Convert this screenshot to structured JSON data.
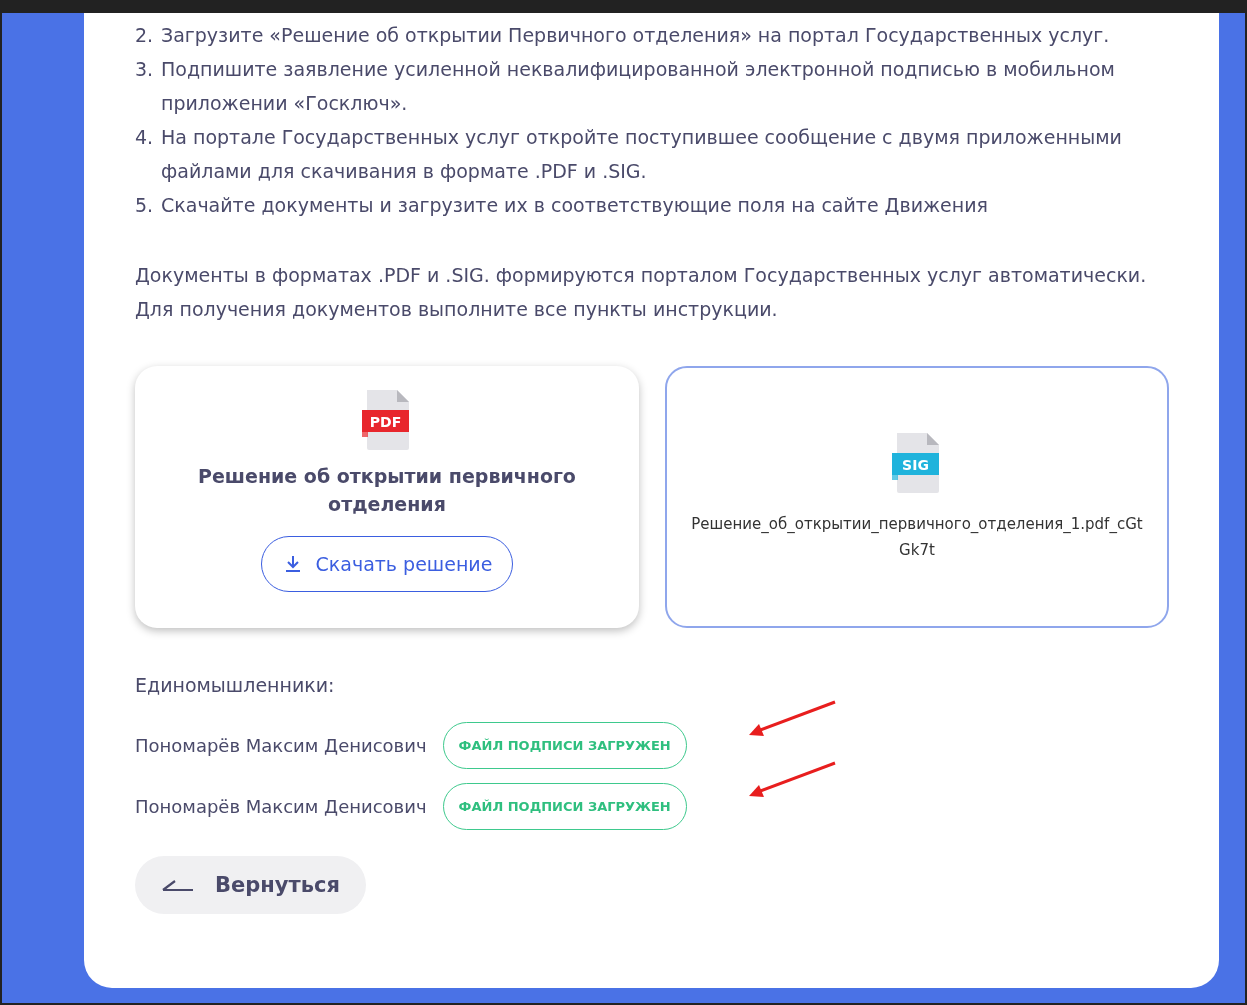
{
  "instructions": [
    {
      "number": "2.",
      "text": "Загрузите «Решение об открытии Первичного отделения» на портал Государственных услуг."
    },
    {
      "number": "3.",
      "text": "Подпишите заявление усиленной неквалифицированной электронной подписью в мобильном приложении «Госключ»."
    },
    {
      "number": "4.",
      "text": "На портале Государственных услуг откройте поступившее сообщение с двумя приложенными файлами для скачивания в формате .PDF и .SIG."
    },
    {
      "number": "5.",
      "text": "Скачайте документы и загрузите их в соответствующие поля на сайте Движения"
    }
  ],
  "note": "Документы в форматах .PDF и .SIG. формируются порталом Государственных услуг автоматически. Для получения документов выполните все пункты инструкции.",
  "files": [
    {
      "kind": "download",
      "badge": "PDF",
      "title": "Решение об открытии первичного отделения",
      "button": "Скачать решение"
    },
    {
      "kind": "uploaded",
      "badge": "SIG",
      "filename": "Решение_об_открытии_первичного_отделения_1.pdf_cGtGk7t"
    }
  ],
  "supporters": {
    "heading": "Единомышленники:",
    "people": [
      {
        "name": "Пономарёв Максим Денисович",
        "status": "ФАЙЛ ПОДПИСИ ЗАГРУЖЕН"
      },
      {
        "name": "Пономарёв Максим Денисович",
        "status": "ФАЙЛ ПОДПИСИ ЗАГРУЖЕН"
      }
    ]
  },
  "back_button": "Вернуться"
}
